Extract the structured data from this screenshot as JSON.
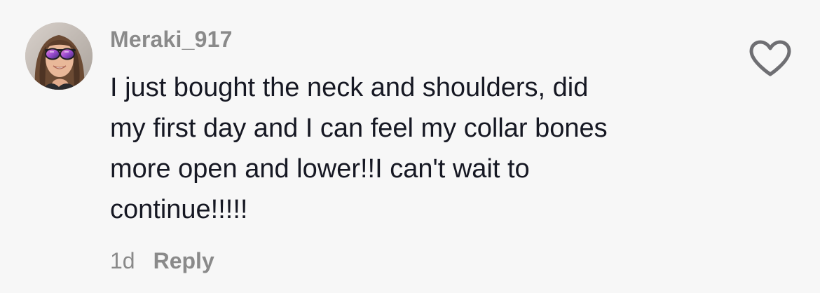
{
  "comment": {
    "username": "Meraki_917",
    "text_lines": [
      "I just bought the neck and shoulders, did",
      "my first day and I can feel my collar bones",
      "more open and lower!!I can't wait to",
      "continue!!!!!"
    ],
    "timestamp": "1d",
    "reply_label": "Reply",
    "like_icon": "heart-outline-icon",
    "avatar": "user-avatar-woman-sunglasses"
  },
  "colors": {
    "background": "#f7f7f7",
    "username": "#8a8a8a",
    "text": "#161823",
    "meta": "#8a8a8a",
    "icon": "#6f6f73"
  }
}
